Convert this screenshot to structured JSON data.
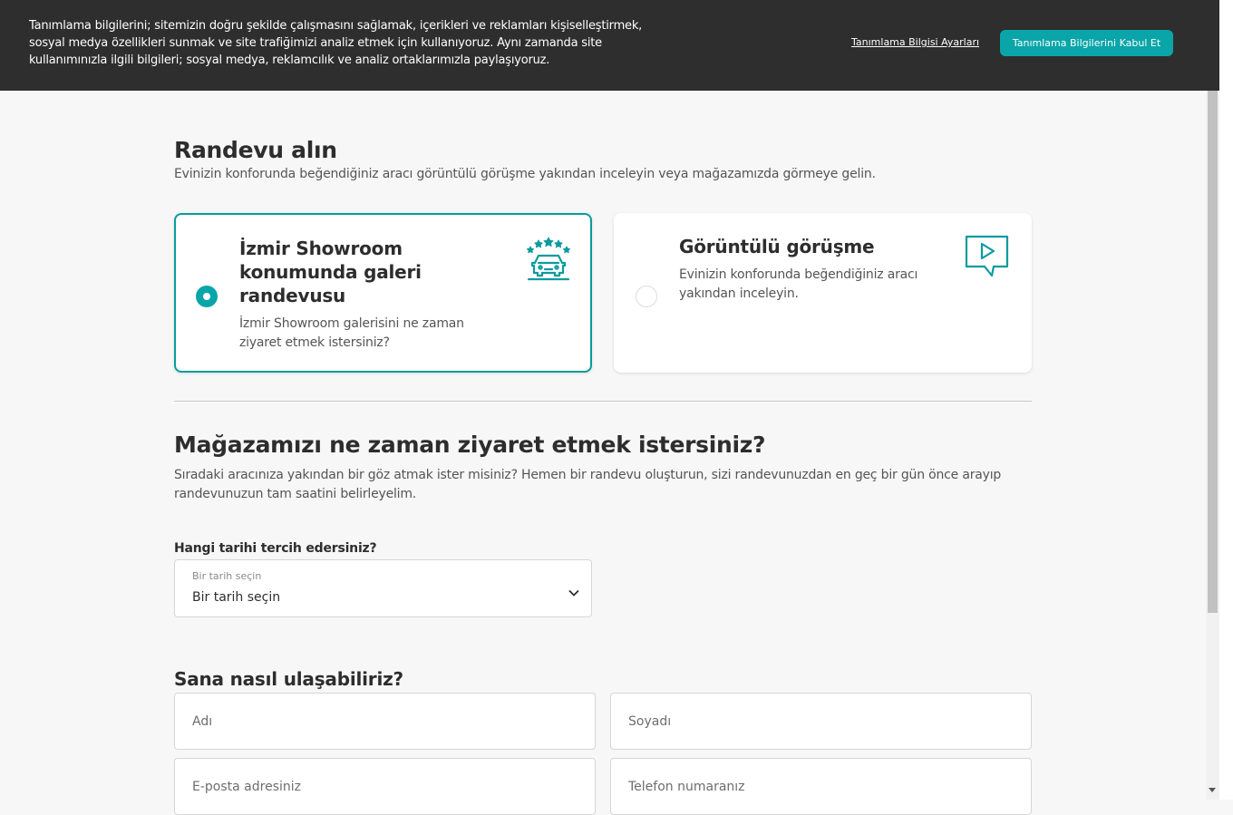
{
  "cookie": {
    "text": "Tanımlama bilgilerini; sitemizin doğru şekilde çalışmasını sağlamak, içerikleri ve reklamları kişiselleştirmek, sosyal medya özellikleri sunmak ve site trafiğimizi analiz etmek için kullanıyoruz. Aynı zamanda site kullanımınızla ilgili bilgileri; sosyal medya, reklamcılık ve analiz ortaklarımızla paylaşıyoruz.",
    "settings_label": "Tanımlama Bilgisi Ayarları",
    "accept_label": "Tanımlama Bilgilerini Kabul Et"
  },
  "appointment": {
    "title": "Randevu alın",
    "subtitle": "Evinizin konforunda beğendiğiniz aracı görüntülü görüşme yakından inceleyin veya mağazamızda görmeye gelin.",
    "options": [
      {
        "title": "İzmir Showroom konumunda galeri randevusu",
        "description": "İzmir Showroom galerisini ne zaman ziyaret etmek istersiniz?",
        "icon": "showroom-car-icon",
        "selected": true
      },
      {
        "title": "Görüntülü görüşme",
        "description": "Evinizin konforunda beğendiğiniz aracı yakından inceleyin.",
        "icon": "video-call-icon",
        "selected": false
      }
    ]
  },
  "visit": {
    "title": "Mağazamızı ne zaman ziyaret etmek istersiniz?",
    "description": "Sıradaki aracınıza yakından bir göz atmak ister misiniz? Hemen bir randevu oluşturun, sizi randevunuzdan en geç bir gün önce arayıp randevunuzun tam saatini belirleyelim.",
    "date_label": "Hangi tarihi tercih edersiniz?",
    "date_select": {
      "small_label": "Bir tarih seçin",
      "value": "Bir tarih seçin"
    }
  },
  "contact": {
    "title": "Sana nasıl ulaşabiliriz?",
    "first_name_placeholder": "Adı",
    "last_name_placeholder": "Soyadı",
    "email_placeholder": "E-posta adresiniz",
    "phone_placeholder": "Telefon numaranız"
  },
  "colors": {
    "accent": "#0aa5a8",
    "banner": "#2e2e2e",
    "background": "#f7f7f7"
  }
}
